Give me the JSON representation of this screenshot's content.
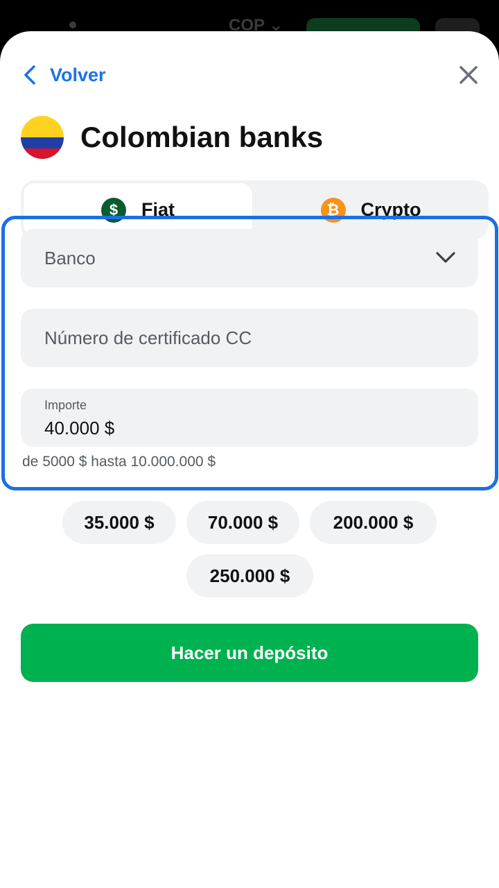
{
  "topbar": {
    "currency": "COP ⌄"
  },
  "nav": {
    "back_label": "Volver"
  },
  "header": {
    "title": "Colombian banks"
  },
  "tabs": [
    {
      "label": "Fiat",
      "icon": "dollar-coin-icon",
      "icon_glyph": "$",
      "color": "#0a5c2f",
      "active": true
    },
    {
      "label": "Crypto",
      "icon": "bitcoin-icon",
      "icon_glyph": "₿",
      "color": "#f7931a",
      "active": false
    }
  ],
  "form": {
    "bank_placeholder": "Banco",
    "certificate_placeholder": "Número de certificado CC",
    "amount_label": "Importe",
    "amount_value": "40.000 $",
    "range_hint": "de 5000 $ hasta 10.000.000 $"
  },
  "quick_amounts": [
    "35.000 $",
    "70.000 $",
    "200.000 $",
    "250.000 $"
  ],
  "submit_label": "Hacer un depósito",
  "colors": {
    "accent": "#1a73e8",
    "primary_button": "#00b14f"
  }
}
